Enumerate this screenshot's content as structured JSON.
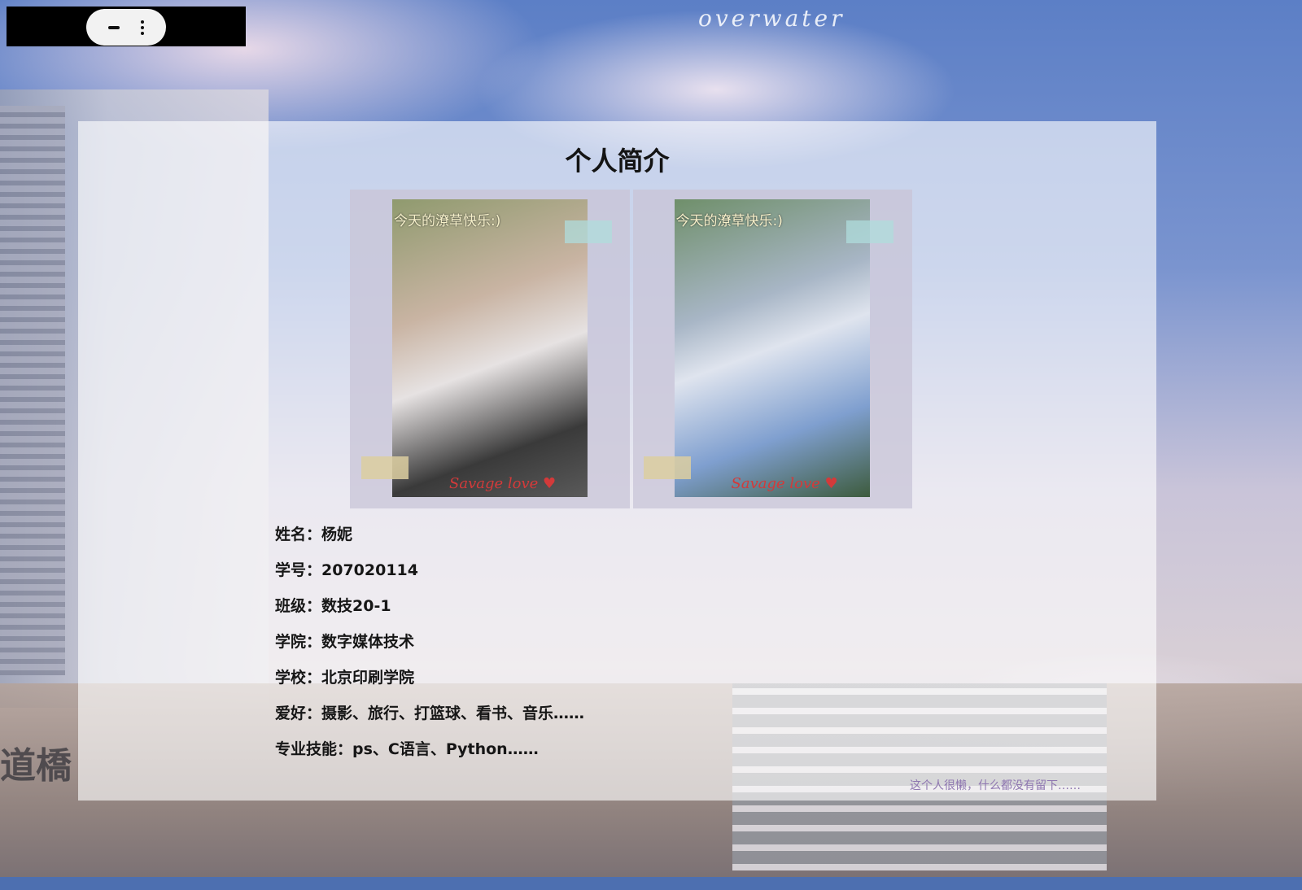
{
  "window": {
    "controls": {
      "minimize_icon": "minimize-icon",
      "menu_icon": "kebab-menu-icon"
    }
  },
  "header": {
    "logo_text": "overwater"
  },
  "profile": {
    "title": "个人简介",
    "photos": [
      {
        "caption": "今天的潦草快乐:)",
        "signature": "Savage love ♥"
      },
      {
        "caption": "今天的潦草快乐:)",
        "signature": "Savage love ♥"
      }
    ],
    "info": [
      "姓名：杨妮",
      "学号：207020114",
      "班级：数技20-1",
      "学院：数字媒体技术",
      "学校：北京印刷学院",
      "爱好：摄影、旅行、打篮球、看书、音乐……",
      "专业技能：ps、C语言、Python……"
    ],
    "footer_note": "这个人很懒，什么都没有留下……"
  },
  "background": {
    "sign_text": "道橋"
  },
  "colors": {
    "card_bg": "#ffffff",
    "footer_note": "#8e76b0",
    "bottom_bar": "#4d6fb0"
  }
}
